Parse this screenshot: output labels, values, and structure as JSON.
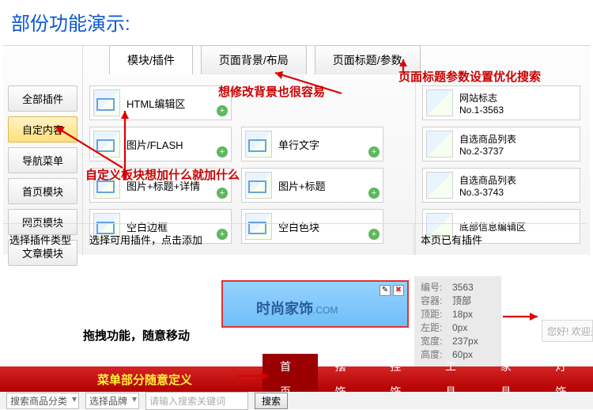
{
  "header_title": "部份功能演示:",
  "tabs": [
    "模块/插件",
    "页面背景/布局",
    "页面标题/参数"
  ],
  "left_sidebar": [
    "全部插件",
    "自定内容",
    "导航菜单",
    "首页模块",
    "网页模块",
    "文章模块"
  ],
  "plugins_mid": [
    "HTML编辑区",
    "图片/FLASH",
    "单行文字",
    "图片+标题+详情",
    "图片+标题",
    "空白边框",
    "空白色块"
  ],
  "plugins_right": [
    {
      "t1": "网站标志",
      "t2": "No.1-3563"
    },
    {
      "t1": "自选商品列表",
      "t2": "No.2-3737"
    },
    {
      "t1": "自选商品列表",
      "t2": "No.3-3743"
    },
    {
      "t1": "底部信息编辑区",
      "t2": ""
    }
  ],
  "footer": {
    "left": "选择插件类型",
    "mid": "选择可用插件，点击添加",
    "right": "本页已有插件"
  },
  "annotations": {
    "a1": "想修改背景也很容易",
    "a2": "页面标题参数设置优化搜索",
    "a3": "自定义板块想加什么就加什么",
    "a4": "拖拽功能，随意移动",
    "a5": "菜单部分随意定义"
  },
  "logo": {
    "text": "时尚家饰",
    "suffix": ".COM"
  },
  "info": [
    {
      "l": "编号:",
      "v": "3563"
    },
    {
      "l": "容器:",
      "v": "顶部"
    },
    {
      "l": "顶距:",
      "v": "18px"
    },
    {
      "l": "左距:",
      "v": "0px"
    },
    {
      "l": "宽度:",
      "v": "237px"
    },
    {
      "l": "高度:",
      "v": "60px"
    }
  ],
  "welcome": "您好! 欢迎光临",
  "menu": [
    "首页",
    "摆饰",
    "挂饰",
    "工具",
    "家具",
    "灯饰"
  ],
  "filters": {
    "cat": "搜索商品分类",
    "brand": "选择品牌",
    "placeholder": "请输入搜索关键词",
    "btn": "搜索"
  }
}
